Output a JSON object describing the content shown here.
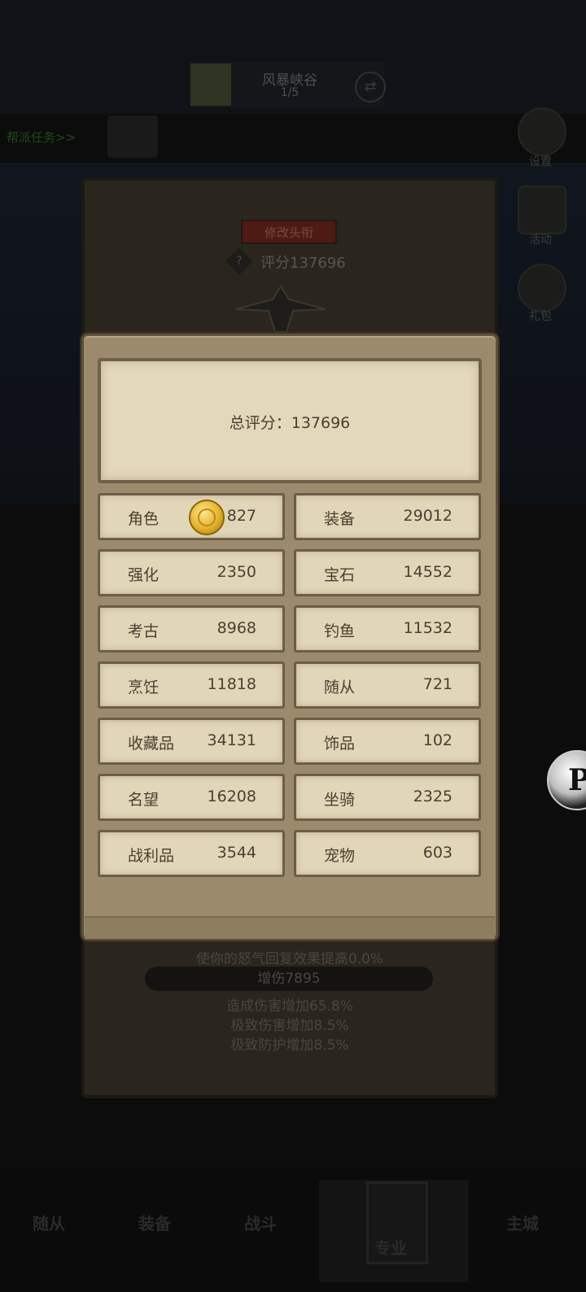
{
  "background": {
    "stage_title": "风暴峡谷",
    "stage_progress": "1/5",
    "task_link": "帮派任务>>",
    "side_menu": [
      "设置",
      "活动",
      "礼包"
    ],
    "edit_avatar_label": "修改头衔",
    "score_label": "评分137696",
    "stats_lines": {
      "rage": "使你的怒气回复效果提高0.0%",
      "damage_bonus": "增伤7895",
      "damage_increase": "造成伤害增加65.8%",
      "extreme_damage": "极致伤害增加8.5%",
      "extreme_defense": "极致防护增加8.5%"
    },
    "bottom_nav": [
      "随从",
      "装备",
      "战斗",
      "专业",
      "主城"
    ]
  },
  "modal": {
    "total_label": "总评分：137696",
    "rows": [
      {
        "left": {
          "label": "角色",
          "value": "827"
        },
        "right": {
          "label": "装备",
          "value": "29012"
        }
      },
      {
        "left": {
          "label": "强化",
          "value": "2350"
        },
        "right": {
          "label": "宝石",
          "value": "14552"
        }
      },
      {
        "left": {
          "label": "考古",
          "value": "8968"
        },
        "right": {
          "label": "钓鱼",
          "value": "11532"
        }
      },
      {
        "left": {
          "label": "烹饪",
          "value": "11818"
        },
        "right": {
          "label": "随从",
          "value": "721"
        }
      },
      {
        "left": {
          "label": "收藏品",
          "value": "34131"
        },
        "right": {
          "label": "饰品",
          "value": "102"
        }
      },
      {
        "left": {
          "label": "名望",
          "value": "16208"
        },
        "right": {
          "label": "坐骑",
          "value": "2325"
        }
      },
      {
        "left": {
          "label": "战利品",
          "value": "3544"
        },
        "right": {
          "label": "宠物",
          "value": "603"
        }
      }
    ]
  },
  "float_button_glyph": "P",
  "colors": {
    "panel": "#9b8a6c",
    "parchment": "#e2d6b8",
    "text": "#4a3f31",
    "coin": "#e2b22c"
  }
}
